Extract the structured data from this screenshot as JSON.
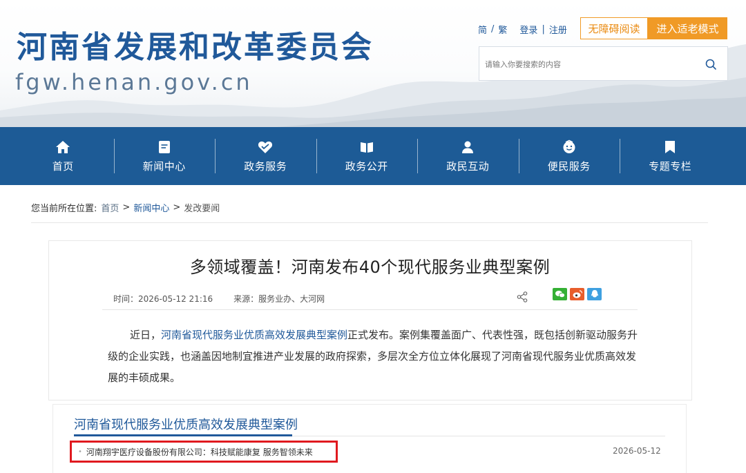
{
  "header": {
    "site_title": "河南省发展和改革委员会",
    "site_domain": "fgw.henan.gov.cn",
    "lang_simplified": "简",
    "lang_separator": "/",
    "lang_traditional": "繁",
    "login": "登录",
    "auth_separator": "|",
    "register": "注册",
    "accessible_reading": "无障碍阅读",
    "elder_mode": "进入适老模式",
    "search_placeholder": "请输入你要搜索的内容"
  },
  "nav": {
    "items": [
      {
        "label": "首页",
        "icon": "home-icon"
      },
      {
        "label": "新闻中心",
        "icon": "news-icon"
      },
      {
        "label": "政务服务",
        "icon": "handshake-heart-icon"
      },
      {
        "label": "政务公开",
        "icon": "open-book-icon"
      },
      {
        "label": "政民互动",
        "icon": "users-icon"
      },
      {
        "label": "便民服务",
        "icon": "smile-face-icon"
      },
      {
        "label": "专题专栏",
        "icon": "bookmark-icon"
      }
    ]
  },
  "breadcrumb": {
    "prefix": "您当前所在位置:",
    "home": "首页",
    "sep": ">",
    "news": "新闻中心",
    "current": "发改要闻"
  },
  "article": {
    "title": "多领域覆盖！河南发布40个现代服务业典型案例",
    "time": "时间：2026-05-12 21:16",
    "source": "来源：服务业办、大河网",
    "body_lead": "近日，",
    "body_link": "河南省现代服务业优质高效发展典型案例",
    "body_rest": "正式发布。案例集覆盖面广、代表性强，既包括创新驱动服务升级的企业实践，也涵盖因地制宜推进产业发展的政府探索，多层次全方位立体化展现了河南省现代服务业优质高效发展的丰硕成果。"
  },
  "case_list": {
    "heading": "河南省现代服务业优质高效发展典型案例",
    "items": [
      {
        "title": "河南翔宇医疗设备股份有限公司：科技赋能康复 服务智领未来",
        "date": "2026-05-12"
      }
    ]
  },
  "colors": {
    "brand_blue": "#1d5b96",
    "link_blue": "#20599a",
    "accent_orange": "#f09a26",
    "highlight_red": "#e0191f"
  }
}
